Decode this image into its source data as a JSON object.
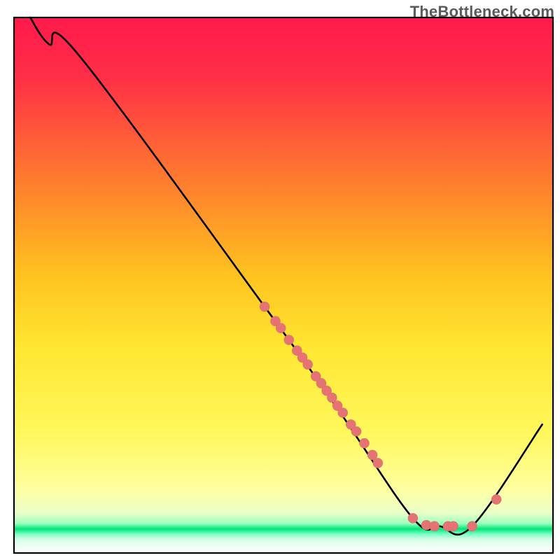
{
  "watermark": "TheBottleneck.com",
  "chart_data": {
    "type": "line",
    "title": "",
    "xlabel": "",
    "ylabel": "",
    "xlim": [
      0,
      100
    ],
    "ylim": [
      0,
      100
    ],
    "grid": false,
    "legend": false,
    "note": "Plot has no visible axis ticks or titles; values below are relative to a 0–100 plot-area coordinate system (y=0 at bottom).",
    "gradient_colors": {
      "top": "#ff1744",
      "upper_mid": "#ffea00",
      "lower_mid": "#ffff8d",
      "green_band": "#00e676",
      "bottom": "#ffffff"
    },
    "line_color": "#000000",
    "dot_color": "#e57373",
    "series": [
      {
        "name": "curve",
        "x": [
          3.0,
          6.5,
          12.0,
          46.5,
          60.0,
          74.0,
          79.0,
          85.0,
          98.0
        ],
        "y": [
          100.0,
          95.0,
          93.0,
          46.0,
          27.0,
          6.5,
          5.0,
          5.0,
          24.0
        ]
      },
      {
        "name": "dots",
        "x": [
          46.5,
          48.5,
          49.5,
          51.0,
          52.5,
          53.5,
          54.5,
          56.0,
          57.0,
          58.0,
          59.0,
          60.0,
          61.0,
          62.5,
          63.5,
          65.0,
          66.5,
          67.5,
          74.0,
          76.5,
          78.0,
          80.5,
          81.5,
          85.0,
          89.5
        ],
        "y": [
          46.0,
          43.3,
          42.0,
          39.8,
          37.8,
          36.5,
          35.2,
          33.0,
          31.7,
          30.3,
          29.0,
          27.5,
          26.2,
          24.0,
          22.7,
          20.5,
          18.3,
          16.8,
          6.5,
          5.2,
          5.0,
          5.0,
          5.0,
          5.0,
          10.0
        ]
      }
    ]
  }
}
